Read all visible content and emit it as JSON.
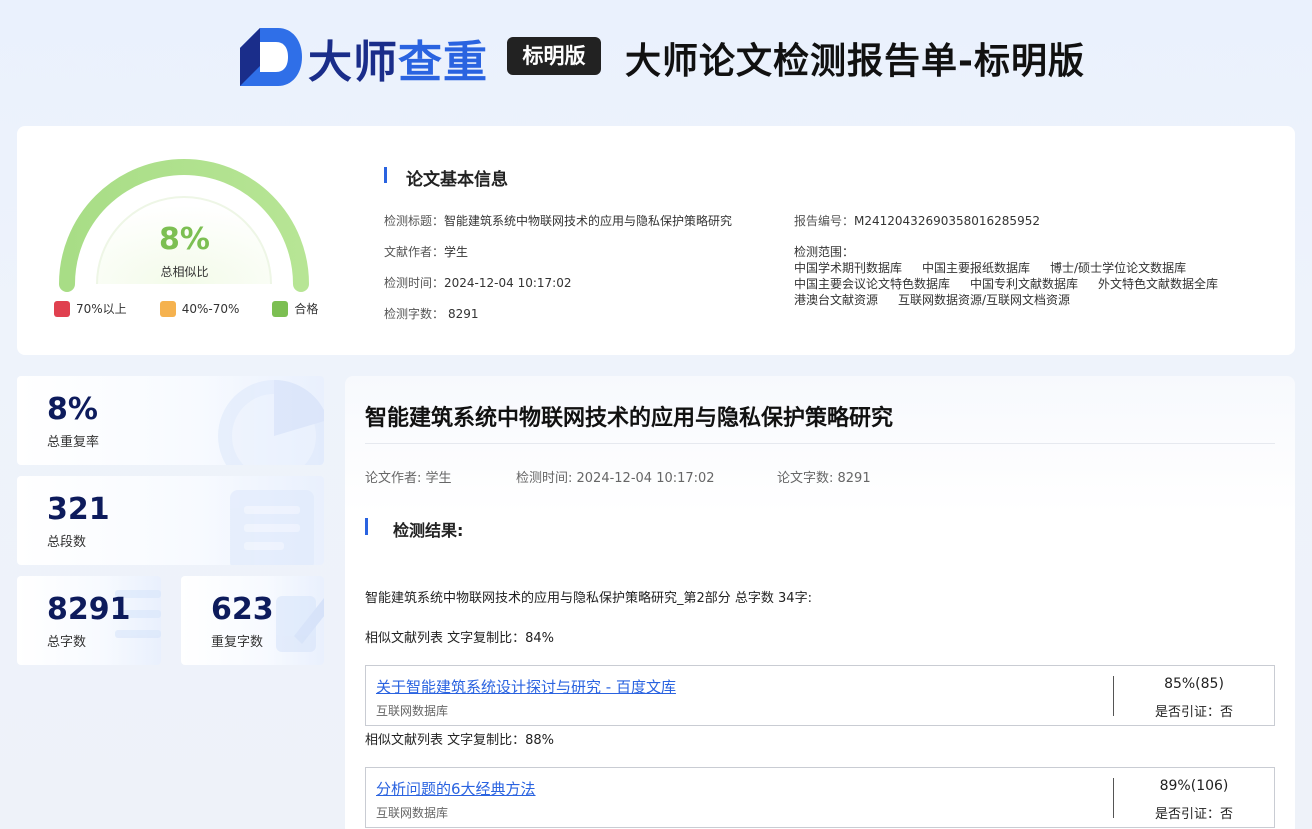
{
  "header": {
    "brand_primary": "大师",
    "brand_secondary": "查重",
    "edition_badge": "标明版",
    "report_title": "大师论文检测报告单-标明版"
  },
  "gauge": {
    "value_text": "8%",
    "value_fraction": 0.08,
    "caption": "总相似比",
    "legend": [
      {
        "label": "70%以上",
        "color": "#e0404f"
      },
      {
        "label": "40%-70%",
        "color": "#f5b24f"
      },
      {
        "label": "合格",
        "color": "#7cbf52"
      }
    ]
  },
  "basic_info": {
    "heading": "论文基本信息",
    "title_key": "检测标题：",
    "title_val": "智能建筑系统中物联网技术的应用与隐私保护策略研究",
    "author_key": "文献作者：",
    "author_val": "学生",
    "time_key": "检测时间：",
    "time_val": "2024-12-04 10:17:02",
    "words_key": "检测字数：",
    "words_val": "8291",
    "report_no_key": "报告编号：",
    "report_no_val": "M241204326903580162859​52",
    "scope_key": "检测范围：",
    "scope": [
      "中国学术期刊数据库",
      "中国主要报纸数据库",
      "博士/硕士学位论文数据库",
      "中国主要会议论文特色数据库",
      "中国专利文献数据库",
      "外文特色文献数据全库",
      "港澳台文献资源",
      "互联网数据资源/互联网文档资源"
    ]
  },
  "stats": {
    "total_rate": {
      "value": "8%",
      "label": "总重复率"
    },
    "paragraphs": {
      "value": "321",
      "label": "总段数"
    },
    "words": {
      "value": "8291",
      "label": "总字数"
    },
    "dup_words": {
      "value": "623",
      "label": "重复字数"
    }
  },
  "main": {
    "doc_title": "智能建筑系统中物联网技术的应用与隐私保护策略研究",
    "author": "论文作者: 学生",
    "time": "检测时间: 2024-12-04 10:17:02",
    "words": "论文字数: 8291",
    "result_heading": "检测结果:",
    "part_line": "智能建筑系统中物联网技术的应用与隐私保护策略研究_第2部分 总字数 34字:",
    "sources": [
      {
        "ratio_line": "相似文献列表 文字复制比：84%",
        "title": "关于智能建筑系统设计探讨与研究 - 百度文库",
        "db": "互联网数据库",
        "pct": "85%(85)",
        "cite": "是否引证：否"
      },
      {
        "ratio_line": "相似文献列表 文字复制比：88%",
        "title": "分析问题的6大经典方法",
        "db": "互联网数据库",
        "pct": "89%(106)",
        "cite": "是否引证：否"
      }
    ]
  }
}
